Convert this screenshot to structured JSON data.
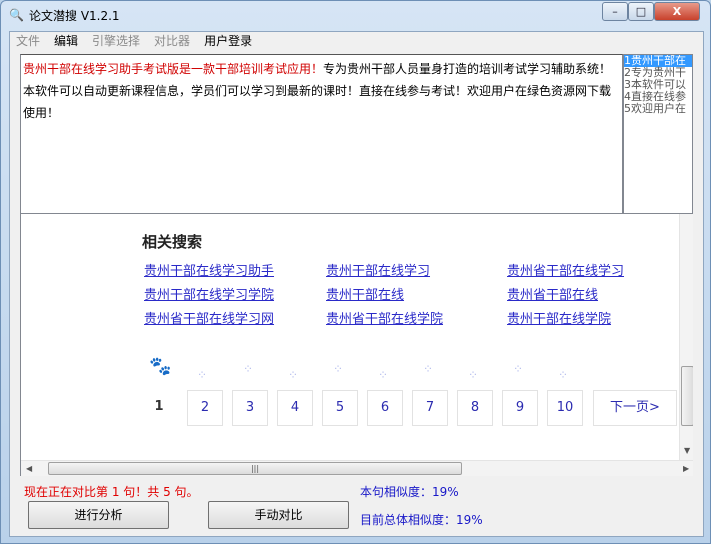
{
  "window": {
    "title": "论文潜搜 V1.2.1",
    "min": "–",
    "max": "□",
    "close": "X"
  },
  "menu": [
    "文件",
    "编辑",
    "引擎选择",
    "对比器",
    "用户登录"
  ],
  "text": {
    "red": "贵州干部在线学习助手考试版是一款干部培训考试应用！",
    "rest": "专为贵州干部人员量身打造的培训考试学习辅助系统！本软件可以自动更新课程信息，学员们可以学习到最新的课时！直接在线参与考试！欢迎用户在绿色资源网下载使用！"
  },
  "sentences": [
    "1贵州干部在",
    "2专为贵州干",
    "3本软件可以",
    "4直接在线参",
    "5欢迎用户在"
  ],
  "related": {
    "title": "相关搜索",
    "links": [
      "贵州干部在线学习助手",
      "贵州干部在线学习",
      "贵州省干部在线学习",
      "贵州干部在线学习学院",
      "贵州干部在线",
      "贵州省干部在线",
      "贵州省干部在线学习网",
      "贵州省干部在线学院",
      "贵州干部在线学院"
    ]
  },
  "pagination": {
    "current": "1",
    "pages": [
      "2",
      "3",
      "4",
      "5",
      "6",
      "7",
      "8",
      "9",
      "10"
    ],
    "next": "下一页>"
  },
  "status": {
    "progress": "现在正在对比第 1 句！共 5 句。",
    "sentence_similarity": "本句相似度：19%",
    "overall_similarity": "目前总体相似度：19%"
  },
  "buttons": {
    "analyze": "进行分析",
    "manual": "手动对比"
  }
}
